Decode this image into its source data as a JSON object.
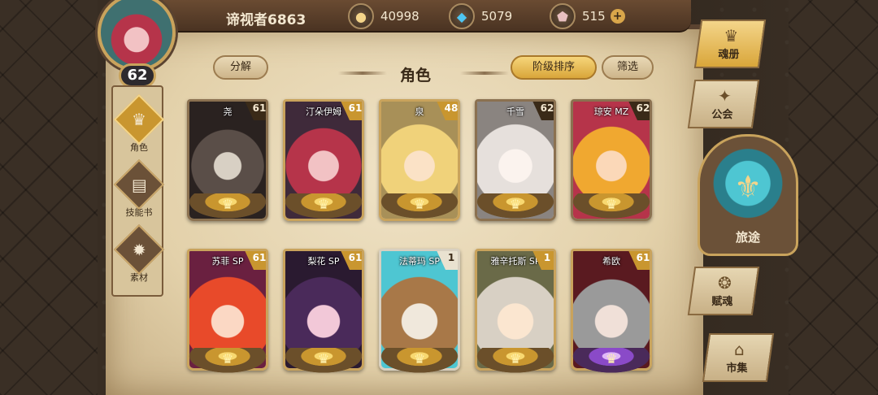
{
  "player": {
    "name": "谛视者6863",
    "level": "62"
  },
  "currencies": [
    {
      "icon": "gold-coin-icon",
      "value": "40998"
    },
    {
      "icon": "blue-crystal-icon",
      "value": "5079"
    },
    {
      "icon": "soul-gem-icon",
      "value": "515",
      "plus": "+"
    }
  ],
  "left_nav": [
    {
      "label": "角色",
      "icon": "character-icon",
      "active": true
    },
    {
      "label": "技能书",
      "icon": "skill-book-icon",
      "active": false
    },
    {
      "label": "素材",
      "icon": "material-icon",
      "active": false
    }
  ],
  "header": {
    "decompose_label": "分解",
    "title": "角色",
    "sort_label": "阶级排序",
    "filter_label": "筛选"
  },
  "characters": [
    {
      "name": "尧",
      "level": "61",
      "frame": "dark",
      "crest": "gold"
    },
    {
      "name": "汀朵伊姆",
      "level": "61",
      "frame": "gold",
      "crest": "gold"
    },
    {
      "name": "泉",
      "level": "48",
      "frame": "gold",
      "crest": "gold"
    },
    {
      "name": "千雪",
      "level": "62",
      "frame": "dark",
      "crest": "gold"
    },
    {
      "name": "琼安 MZ",
      "level": "62",
      "frame": "dark",
      "crest": "gold"
    },
    {
      "name": "苏菲 SP",
      "level": "61",
      "frame": "gold",
      "crest": "gold"
    },
    {
      "name": "梨花 SP",
      "level": "61",
      "frame": "gold",
      "crest": "gold"
    },
    {
      "name": "法蒂玛 SP",
      "level": "1",
      "frame": "light",
      "crest": "gold"
    },
    {
      "name": "雅辛托斯 SP",
      "level": "1",
      "frame": "gold",
      "crest": "gold"
    },
    {
      "name": "希欧",
      "level": "61",
      "frame": "gold",
      "crest": "purple"
    }
  ],
  "right_nav": [
    {
      "label": "魂册",
      "icon": "soul-book-icon",
      "active": true
    },
    {
      "label": "公会",
      "icon": "guild-icon",
      "active": false
    },
    {
      "label": "旅途",
      "icon": "journey-icon",
      "active": false
    },
    {
      "label": "赋魂",
      "icon": "endow-soul-icon",
      "active": false
    },
    {
      "label": "市集",
      "icon": "market-icon",
      "active": false
    }
  ],
  "colors": {
    "parchment": "#e3d1aa",
    "gold": "#c9962f",
    "frame": "#5a4330"
  }
}
